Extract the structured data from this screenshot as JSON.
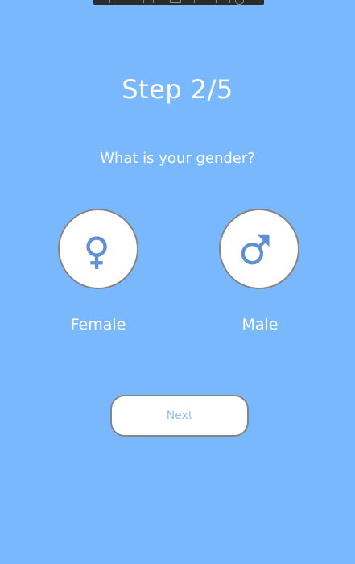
{
  "header": {
    "step_title": "Step 2/5",
    "question": "What is your gender?"
  },
  "options": [
    {
      "label": "Female",
      "icon": "female-symbol-icon"
    },
    {
      "label": "Male",
      "icon": "male-symbol-icon"
    }
  ],
  "actions": {
    "next_label": "Next"
  },
  "colors": {
    "background": "#7ab8fe",
    "icon": "#5f90d4",
    "button_text": "#8ec1f5",
    "border": "#858585"
  }
}
